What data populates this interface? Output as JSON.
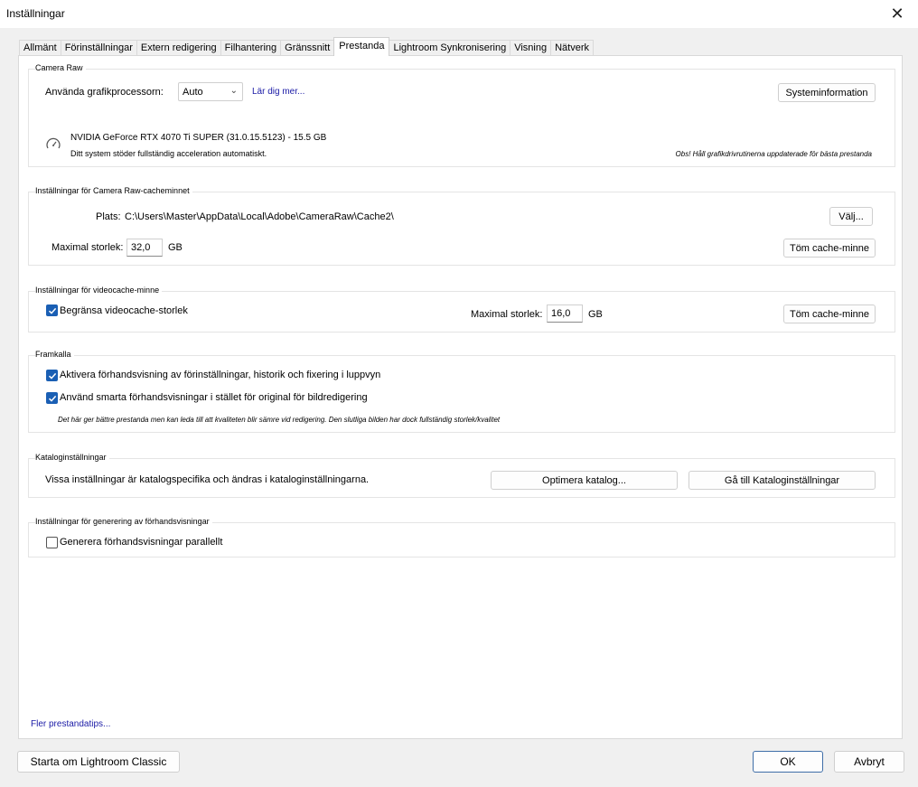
{
  "window": {
    "title": "Inställningar"
  },
  "tabs": [
    {
      "label": "Allmänt"
    },
    {
      "label": "Förinställningar"
    },
    {
      "label": "Extern redigering"
    },
    {
      "label": "Filhantering"
    },
    {
      "label": "Gränssnitt"
    },
    {
      "label": "Prestanda",
      "active": true
    },
    {
      "label": "Lightroom Synkronisering"
    },
    {
      "label": "Visning"
    },
    {
      "label": "Nätverk"
    }
  ],
  "camera_raw": {
    "title": "Camera Raw",
    "gpu_label": "Använda grafikprocessorn:",
    "gpu_value": "Auto",
    "learn_more": "Lär dig mer...",
    "sysinfo_button": "Systeminformation",
    "gpu_name": "NVIDIA GeForce RTX 4070 Ti SUPER (31.0.15.5123) - 15.5 GB",
    "gpu_status": "Ditt system stöder fullständig acceleration automatiskt.",
    "driver_note": "Obs! Håll grafikdrivrutinerna uppdaterade för bästa prestanda"
  },
  "raw_cache": {
    "title": "Inställningar för Camera Raw-cacheminnet",
    "location_label": "Plats:",
    "location_value": "C:\\Users\\Master\\AppData\\Local\\Adobe\\CameraRaw\\Cache2\\",
    "choose_button": "Välj...",
    "max_size_label": "Maximal storlek:",
    "max_size_value": "32,0",
    "unit": "GB",
    "purge_button": "Töm cache-minne"
  },
  "video_cache": {
    "title": "Inställningar för videocache-minne",
    "limit_label": "Begränsa videocache-storlek",
    "limit_checked": true,
    "max_size_label": "Maximal storlek:",
    "max_size_value": "16,0",
    "unit": "GB",
    "purge_button": "Töm cache-minne"
  },
  "develop": {
    "title": "Framkalla",
    "option1": "Aktivera förhandsvisning av förinställningar, historik och fixering i luppvyn",
    "option1_checked": true,
    "option2": "Använd smarta förhandsvisningar i stället för original för bildredigering",
    "option2_checked": true,
    "note": "Det här ger bättre prestanda men kan leda till att kvaliteten blir sämre vid redigering. Den slutliga bilden har dock fullständig storlek/kvalitet"
  },
  "catalog": {
    "title": "Kataloginställningar",
    "text": "Vissa inställningar är katalogspecifika och ändras i kataloginställningarna.",
    "optimize_button": "Optimera katalog...",
    "goto_button": "Gå till Kataloginställningar"
  },
  "preview_gen": {
    "title": "Inställningar för generering av förhandsvisningar",
    "parallel_label": "Generera förhandsvisningar parallellt",
    "parallel_checked": false
  },
  "more_tips": "Fler prestandatips...",
  "footer": {
    "restart_button": "Starta om Lightroom Classic",
    "ok_button": "OK",
    "cancel_button": "Avbryt"
  }
}
